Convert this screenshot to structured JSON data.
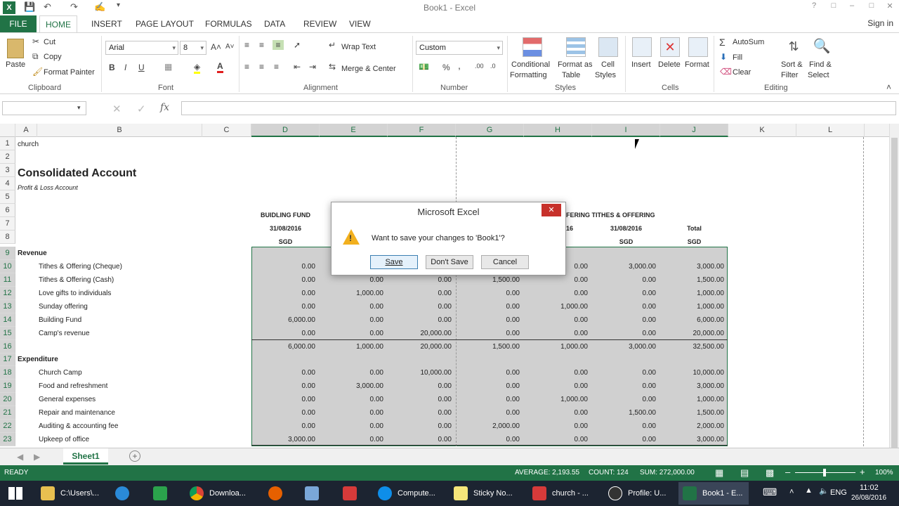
{
  "window": {
    "title": "Book1 - Excel",
    "signin": "Sign in"
  },
  "tabs": [
    "FILE",
    "HOME",
    "INSERT",
    "PAGE LAYOUT",
    "FORMULAS",
    "DATA",
    "REVIEW",
    "VIEW"
  ],
  "ribbon": {
    "clipboard": {
      "paste": "Paste",
      "cut": "Cut",
      "copy": "Copy",
      "format_painter": "Format Painter",
      "label": "Clipboard"
    },
    "font": {
      "name": "Arial",
      "size": "8",
      "label": "Font"
    },
    "alignment": {
      "wrap_text": "Wrap Text",
      "merge_center": "Merge & Center",
      "label": "Alignment"
    },
    "number": {
      "format": "Custom",
      "percent": "%",
      "comma": ",",
      "label": "Number"
    },
    "styles": {
      "conditional": "Conditional",
      "conditional2": "Formatting",
      "format_as": "Format as",
      "format_as2": "Table",
      "cell": "Cell",
      "cell2": "Styles",
      "label": "Styles"
    },
    "cells": {
      "insert": "Insert",
      "delete": "Delete",
      "format": "Format",
      "label": "Cells"
    },
    "editing": {
      "autosum": "AutoSum",
      "fill": "Fill",
      "clear": "Clear",
      "sort": "Sort &",
      "sort2": "Filter",
      "find": "Find &",
      "find2": "Select",
      "label": "Editing"
    }
  },
  "formula_bar": {
    "name_box": "",
    "fx": "fx",
    "value": ""
  },
  "columns": [
    "A",
    "B",
    "C",
    "D",
    "E",
    "F",
    "G",
    "H",
    "I",
    "J",
    "K",
    "L"
  ],
  "cells": {
    "r1": "church",
    "r3": "Consolidated Account",
    "r4": "Profit & Loss Account",
    "r6_d": "BUIDLING FUND",
    "r6_i": "FERING TITHES & OFFERING",
    "r7_d": "31/08/2016",
    "r7_h": "16",
    "r7_i": "31/08/2016",
    "r7_j": "Total",
    "r8_d": "SGD",
    "r8_i": "SGD",
    "r8_j": "SGD",
    "r9": "Revenue",
    "r17": "Expenditure"
  },
  "rows": [
    {
      "n": "10",
      "label": "Tithes & Offering (Cheque)",
      "vals": [
        "0.00",
        "",
        "",
        "",
        "0.00",
        "3,000.00",
        "3,000.00"
      ]
    },
    {
      "n": "11",
      "label": "Tithes & Offering (Cash)",
      "vals": [
        "0.00",
        "0.00",
        "0.00",
        "1,500.00",
        "0.00",
        "0.00",
        "1,500.00"
      ]
    },
    {
      "n": "12",
      "label": "Love gifts to individuals",
      "vals": [
        "0.00",
        "1,000.00",
        "0.00",
        "0.00",
        "0.00",
        "0.00",
        "1,000.00"
      ]
    },
    {
      "n": "13",
      "label": "Sunday offering",
      "vals": [
        "0.00",
        "0.00",
        "0.00",
        "0.00",
        "1,000.00",
        "0.00",
        "1,000.00"
      ]
    },
    {
      "n": "14",
      "label": "Building Fund",
      "vals": [
        "6,000.00",
        "0.00",
        "0.00",
        "0.00",
        "0.00",
        "0.00",
        "6,000.00"
      ]
    },
    {
      "n": "15",
      "label": "Camp's revenue",
      "vals": [
        "0.00",
        "0.00",
        "20,000.00",
        "0.00",
        "0.00",
        "0.00",
        "20,000.00"
      ]
    },
    {
      "n": "16",
      "label": "",
      "vals": [
        "6,000.00",
        "1,000.00",
        "20,000.00",
        "1,500.00",
        "1,000.00",
        "3,000.00",
        "32,500.00"
      ]
    },
    {
      "n": "18",
      "label": "Church Camp",
      "vals": [
        "0.00",
        "0.00",
        "10,000.00",
        "0.00",
        "0.00",
        "0.00",
        "10,000.00"
      ]
    },
    {
      "n": "19",
      "label": "Food and refreshment",
      "vals": [
        "0.00",
        "3,000.00",
        "0.00",
        "0.00",
        "0.00",
        "0.00",
        "3,000.00"
      ]
    },
    {
      "n": "20",
      "label": "General expenses",
      "vals": [
        "0.00",
        "0.00",
        "0.00",
        "0.00",
        "1,000.00",
        "0.00",
        "1,000.00"
      ]
    },
    {
      "n": "21",
      "label": "Repair and maintenance",
      "vals": [
        "0.00",
        "0.00",
        "0.00",
        "0.00",
        "0.00",
        "1,500.00",
        "1,500.00"
      ]
    },
    {
      "n": "22",
      "label": "Auditing & accounting fee",
      "vals": [
        "0.00",
        "0.00",
        "0.00",
        "2,000.00",
        "0.00",
        "0.00",
        "2,000.00"
      ]
    },
    {
      "n": "23",
      "label": "Upkeep of office",
      "vals": [
        "3,000.00",
        "0.00",
        "0.00",
        "0.00",
        "0.00",
        "0.00",
        "3,000.00"
      ]
    }
  ],
  "dialog": {
    "title": "Microsoft Excel",
    "message": "Want to save your changes to 'Book1'?",
    "save": "Save",
    "dont_save": "Don't Save",
    "cancel": "Cancel"
  },
  "sheet_tab": "Sheet1",
  "status": {
    "ready": "READY",
    "average": "AVERAGE: 2,193.55",
    "count": "COUNT: 124",
    "sum": "SUM: 272,000.00",
    "zoom": "100%"
  },
  "taskbar": {
    "items": [
      "C:\\Users\\...",
      "Downloa...",
      "Compute...",
      "Sticky No...",
      "church - ...",
      "Profile: U...",
      "Book1 - E..."
    ],
    "lang": "ENG",
    "time": "11:02",
    "date": "26/08/2016"
  },
  "colors": {
    "excel_green": "#217346",
    "dialog_close": "#c7312b"
  }
}
